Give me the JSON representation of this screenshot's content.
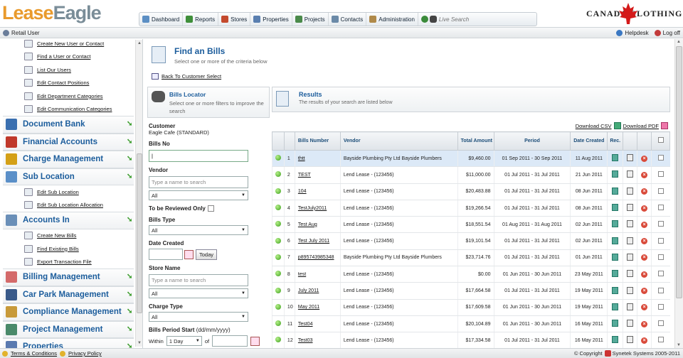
{
  "header": {
    "logo_part1": "Lease",
    "logo_part2": "Eagle",
    "brand_right": "CANADA  CLOTHING",
    "menu": [
      {
        "label": "Dashboard",
        "color": "#5c8fc4"
      },
      {
        "label": "Reports",
        "color": "#3f8f3a"
      },
      {
        "label": "Stores",
        "color": "#c44a2d"
      },
      {
        "label": "Properties",
        "color": "#5a7fb0"
      },
      {
        "label": "Projects",
        "color": "#4a8a4a"
      },
      {
        "label": "Contacts",
        "color": "#6b8aa8"
      },
      {
        "label": "Administration",
        "color": "#b08a4a"
      }
    ],
    "search_placeholder": "Live Search"
  },
  "userbar": {
    "user": "Retail User",
    "helpdesk": "Helpdesk",
    "logoff": "Log off"
  },
  "sidebar": {
    "items": [
      {
        "kind": "sub",
        "label": "Create New User or Contact"
      },
      {
        "kind": "sub",
        "label": "Find a User or Contact"
      },
      {
        "kind": "sub",
        "label": "List Our Users"
      },
      {
        "kind": "sub",
        "label": "Edit Contact Positions"
      },
      {
        "kind": "sub",
        "label": "Edit Department Categories"
      },
      {
        "kind": "sub",
        "label": "Edit Communication Categories"
      },
      {
        "kind": "sec",
        "label": "Document Bank",
        "color": "#3a6fb0"
      },
      {
        "kind": "sec",
        "label": "Financial Accounts",
        "color": "#c0392b"
      },
      {
        "kind": "sec",
        "label": "Charge Management",
        "color": "#d4a017"
      },
      {
        "kind": "sec",
        "label": "Sub Location",
        "color": "#5a8fc8"
      },
      {
        "kind": "sub",
        "label": "Edit Sub Location"
      },
      {
        "kind": "sub",
        "label": "Edit Sub Location Allocation"
      },
      {
        "kind": "sec",
        "label": "Accounts In",
        "color": "#6a8fb8"
      },
      {
        "kind": "sub",
        "label": "Create New Bills"
      },
      {
        "kind": "sub",
        "label": "Find Existing Bills"
      },
      {
        "kind": "sub",
        "label": "Export Transaction File"
      },
      {
        "kind": "sec",
        "label": "Billing Management",
        "color": "#d46a6a"
      },
      {
        "kind": "sec",
        "label": "Car Park Management",
        "color": "#3a5a8a"
      },
      {
        "kind": "sec",
        "label": "Compliance Management",
        "color": "#c89a3a"
      },
      {
        "kind": "sec",
        "label": "Project Management",
        "color": "#4a8a6a"
      },
      {
        "kind": "sec",
        "label": "Properties",
        "color": "#5a7ab0"
      }
    ]
  },
  "page": {
    "title": "Find an Bills",
    "subtitle": "Select one or more of the criteria below",
    "back_link": "Back To Customer Select"
  },
  "filters": {
    "title": "Bills Locator",
    "subtitle": "Select one or more filters to improve the search",
    "customer_label": "Customer",
    "customer_value": "Eagle Cafe (STANDARD)",
    "bills_no_label": "Bills No",
    "vendor_label": "Vendor",
    "vendor_placeholder": "Type a name to search",
    "vendor_select": "All",
    "review_label": "To be Reviewed Only",
    "bills_type_label": "Bills Type",
    "bills_type_value": "All",
    "date_created_label": "Date Created",
    "today_label": "Today",
    "store_name_label": "Store Name",
    "store_placeholder": "Type a name to search",
    "store_select": "All",
    "charge_type_label": "Charge Type",
    "charge_type_value": "All",
    "period_label": "Bills Period Start",
    "period_format": "(dd/mm/yyyy)",
    "within_label": "Within",
    "within_value": "1 Day",
    "of_label": "of"
  },
  "results": {
    "title": "Results",
    "subtitle": "The results of your search are listed below",
    "download_csv": "Download CSV",
    "download_pdf": "Download PDF",
    "columns": [
      "Bills Number",
      "Vendor",
      "Total Amount",
      "Period",
      "Date Created",
      "Rec."
    ],
    "rows": [
      {
        "n": "1",
        "bill": "thtt",
        "vendor": "Bayside Plumbing Pty Ltd Bayside Plumbers",
        "amount": "$9,460.00",
        "period": "01 Sep 2011 - 30 Sep 2011",
        "created": "11 Aug 2011"
      },
      {
        "n": "2",
        "bill": "TEST",
        "vendor": "Lend Lease - (123456)",
        "amount": "$11,000.00",
        "period": "01 Jul 2011 - 31 Jul 2011",
        "created": "21 Jun 2011"
      },
      {
        "n": "3",
        "bill": "104",
        "vendor": "Lend Lease - (123456)",
        "amount": "$20,483.88",
        "period": "01 Jul 2011 - 31 Jul 2011",
        "created": "08 Jun 2011"
      },
      {
        "n": "4",
        "bill": "TestJuly2011",
        "vendor": "Lend Lease - (123456)",
        "amount": "$19,266.54",
        "period": "01 Jul 2011 - 31 Jul 2011",
        "created": "08 Jun 2011"
      },
      {
        "n": "5",
        "bill": "Test Aug",
        "vendor": "Lend Lease - (123456)",
        "amount": "$18,551.54",
        "period": "01 Aug 2011 - 31 Aug 2011",
        "created": "02 Jun 2011"
      },
      {
        "n": "6",
        "bill": "Test July 2011",
        "vendor": "Lend Lease - (123456)",
        "amount": "$19,101.54",
        "period": "01 Jul 2011 - 31 Jul 2011",
        "created": "02 Jun 2011"
      },
      {
        "n": "7",
        "bill": "p895743985348",
        "vendor": "Bayside Plumbing Pty Ltd Bayside Plumbers",
        "amount": "$23,714.76",
        "period": "01 Jul 2011 - 31 Jul 2011",
        "created": "01 Jun 2011"
      },
      {
        "n": "8",
        "bill": "test",
        "vendor": "Lend Lease - (123456)",
        "amount": "$0.00",
        "period": "01 Jun 2011 - 30 Jun 2011",
        "created": "23 May 2011"
      },
      {
        "n": "9",
        "bill": "July 2011",
        "vendor": "Lend Lease - (123456)",
        "amount": "$17,664.58",
        "period": "01 Jul 2011 - 31 Jul 2011",
        "created": "19 May 2011"
      },
      {
        "n": "10",
        "bill": "May 2011",
        "vendor": "Lend Lease - (123456)",
        "amount": "$17,609.58",
        "period": "01 Jun 2011 - 30 Jun 2011",
        "created": "19 May 2011"
      },
      {
        "n": "11",
        "bill": "Test04",
        "vendor": "Lend Lease - (123456)",
        "amount": "$20,104.89",
        "period": "01 Jun 2011 - 30 Jun 2011",
        "created": "16 May 2011"
      },
      {
        "n": "12",
        "bill": "Test03",
        "vendor": "Lend Lease - (123456)",
        "amount": "$17,334.58",
        "period": "01 Jul 2011 - 31 Jul 2011",
        "created": "16 May 2011"
      }
    ]
  },
  "footer": {
    "terms": "Terms & Conditions",
    "privacy": "Privacy Policy",
    "copyright_prefix": "© Copyright",
    "company": "Synetek Systems 2005-2011"
  }
}
